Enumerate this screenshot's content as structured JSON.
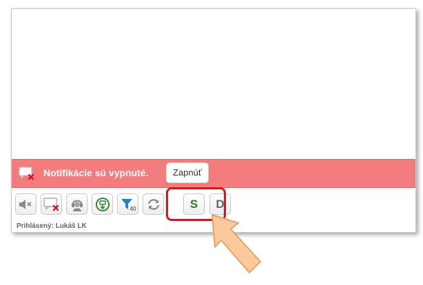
{
  "notification": {
    "text": "Notifikácie sú vypnuté.",
    "enable_label": "Zapnúť",
    "bar_color": "#f47b7b"
  },
  "toolbar": {
    "buttons": [
      {
        "name": "mute-button",
        "icon": "speaker-mute-icon"
      },
      {
        "name": "notifications-off-button",
        "icon": "message-x-icon"
      },
      {
        "name": "agent-button",
        "icon": "headset-agent-icon"
      },
      {
        "name": "download-button",
        "icon": "circle-download-icon"
      },
      {
        "name": "filter-button",
        "icon": "filter-icon",
        "badge": "40"
      },
      {
        "name": "refresh-button",
        "icon": "refresh-icon"
      },
      {
        "name": "s-button",
        "label": "S",
        "color": "#2e7d1a"
      },
      {
        "name": "d-button",
        "label": "D",
        "color": "#666666"
      }
    ]
  },
  "status": {
    "logged_in": "Prihlásený: Lukáš LK"
  },
  "annotation": {
    "highlight_color": "#d9141e",
    "arrow_color": "#fbc99b"
  }
}
